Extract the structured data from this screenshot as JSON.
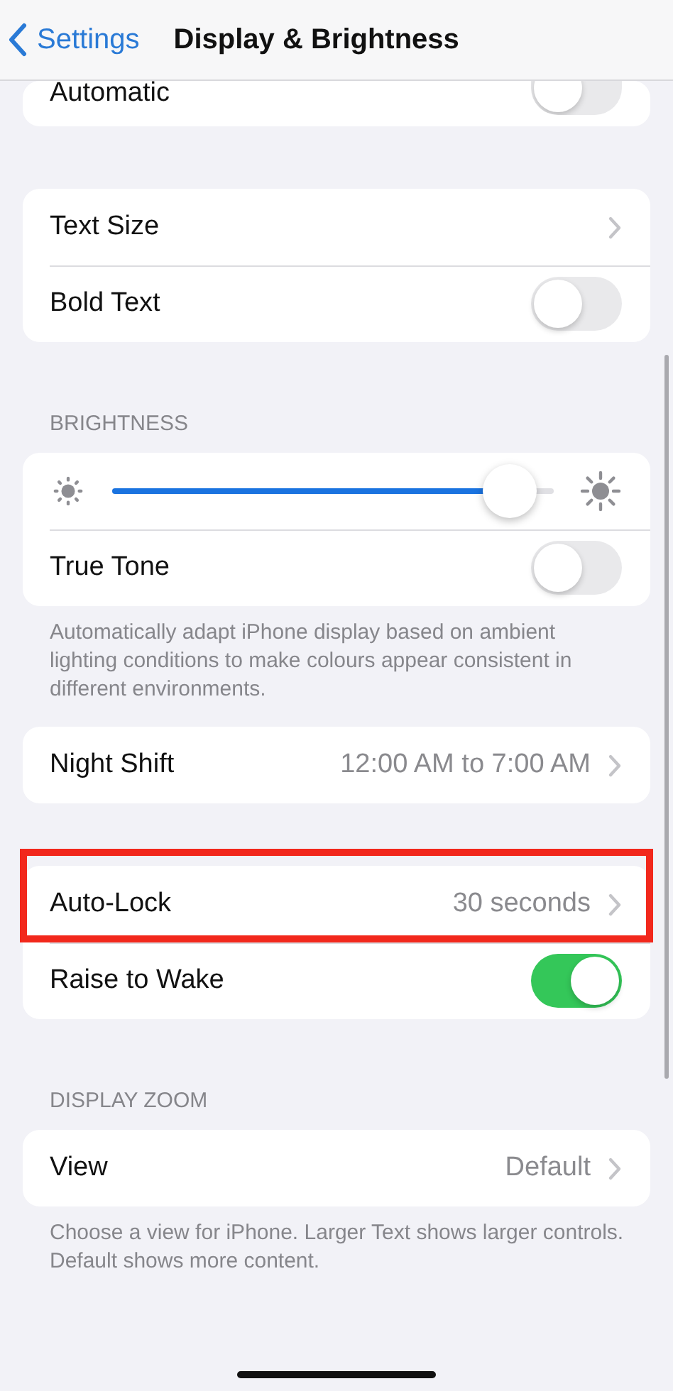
{
  "nav": {
    "back": "Settings",
    "title": "Display & Brightness"
  },
  "groups": [
    {
      "rows": [
        {
          "kind": "toggle",
          "label": "Automatic",
          "on": false,
          "highlighted": false
        }
      ]
    },
    {
      "rows": [
        {
          "kind": "link",
          "label": "Text Size",
          "highlighted": false
        },
        {
          "kind": "toggle",
          "label": "Bold Text",
          "on": false,
          "highlighted": false
        }
      ]
    },
    {
      "header": "BRIGHTNESS",
      "rows": [
        {
          "kind": "slider",
          "level": 0.9,
          "highlighted": false
        },
        {
          "kind": "toggle",
          "label": "True Tone",
          "on": false,
          "highlighted": false
        }
      ],
      "footer": "Automatically adapt iPhone display based on ambient lighting conditions to make colours appear consistent in different environments."
    },
    {
      "rows": [
        {
          "kind": "link",
          "label": "Night Shift",
          "value": "12:00 AM to 7:00 AM",
          "highlighted": false
        }
      ]
    },
    {
      "rows": [
        {
          "kind": "link",
          "label": "Auto-Lock",
          "value": "30 seconds",
          "highlighted": true
        },
        {
          "kind": "toggle",
          "label": "Raise to Wake",
          "on": true,
          "highlighted": false
        }
      ]
    },
    {
      "header": "DISPLAY ZOOM",
      "rows": [
        {
          "kind": "link",
          "label": "View",
          "value": "Default",
          "highlighted": false
        }
      ],
      "footer": "Choose a view for iPhone. Larger Text shows larger controls. Default shows more content."
    }
  ]
}
